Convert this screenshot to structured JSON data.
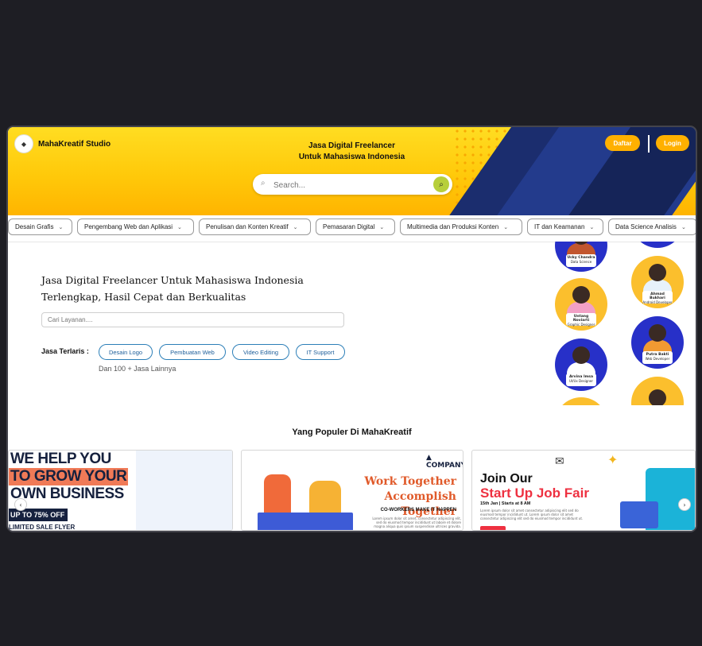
{
  "header": {
    "brand": "MahaKreatif Studio",
    "headline_line1": "Jasa Digital Freelancer",
    "headline_line2": "Untuk Mahasiswa Indonesia",
    "search_placeholder": "Search...",
    "daftar_label": "Daftar",
    "login_label": "Login"
  },
  "categories": [
    "Desain Grafis",
    "Pengembang Web dan Aplikasi",
    "Penulisan dan Konten Kreatif",
    "Pemasaran Digital",
    "Multimedia dan Produksi Konten",
    "IT dan Keamanan",
    "Data Science Analisis"
  ],
  "main": {
    "tagline_line1": "Jasa Digital Freelancer Untuk Mahasiswa Indonesia",
    "tagline_line2": "Terlengkap, Hasil Cepat dan Berkualitas",
    "search_placeholder": "Cari Layanan....",
    "bestseller_label": "Jasa Terlaris :",
    "bestseller_chips": [
      "Desain Logo",
      "Pembuatan Web",
      "Video Editing",
      "IT Support"
    ],
    "more_text": "Dan 100 + Jasa Lainnya"
  },
  "freelancers": [
    {
      "name": "Ucky Chandra",
      "role": "Data Science"
    },
    {
      "name": "Ahmad Bukhari",
      "role": "Android Developer"
    },
    {
      "name": "Untang Noviarti",
      "role": "Graphic Designer"
    },
    {
      "name": "Putra Bakti",
      "role": "Web Developer"
    },
    {
      "name": "Arvina Imsa",
      "role": "UI/Ux Designer"
    }
  ],
  "popular": {
    "title": "Yang Populer Di MahaKreatif",
    "card1": {
      "line1": "WE HELP YOU",
      "line2": "TO GROW YOUR",
      "line3": "OWN BUSINESS",
      "offer": "UP TO 75% OFF",
      "footer": "LIMITED SALE FLYER"
    },
    "card2": {
      "company": "COMPANY",
      "title_line1": "Work Together",
      "title_line2": "Accomplish Together",
      "subtitle": "CO-WORKERS MAKE IT HAPPEN",
      "body": "Lorem ipsum dolor sit amet, consectetur adipiscing elit, sed do eiusmod tempor incididunt ut labore et dolore magna aliqua quis ipsum suspendisse ultrices gravida."
    },
    "card3": {
      "title_line1": "Join Our",
      "title_line2": "Start Up Job Fair",
      "date": "15th Jan | Starts at 8 AM",
      "body": "Lorem ipsum dolor sit amet consectetur adipiscing elit sed do eiusmod tempor incididunt ut. Lorem ipsum dolor sit amet consectetur adipiscing elit sed do eiusmod tempor incididunt ut."
    },
    "prev_icon": "‹",
    "next_icon": "›"
  }
}
